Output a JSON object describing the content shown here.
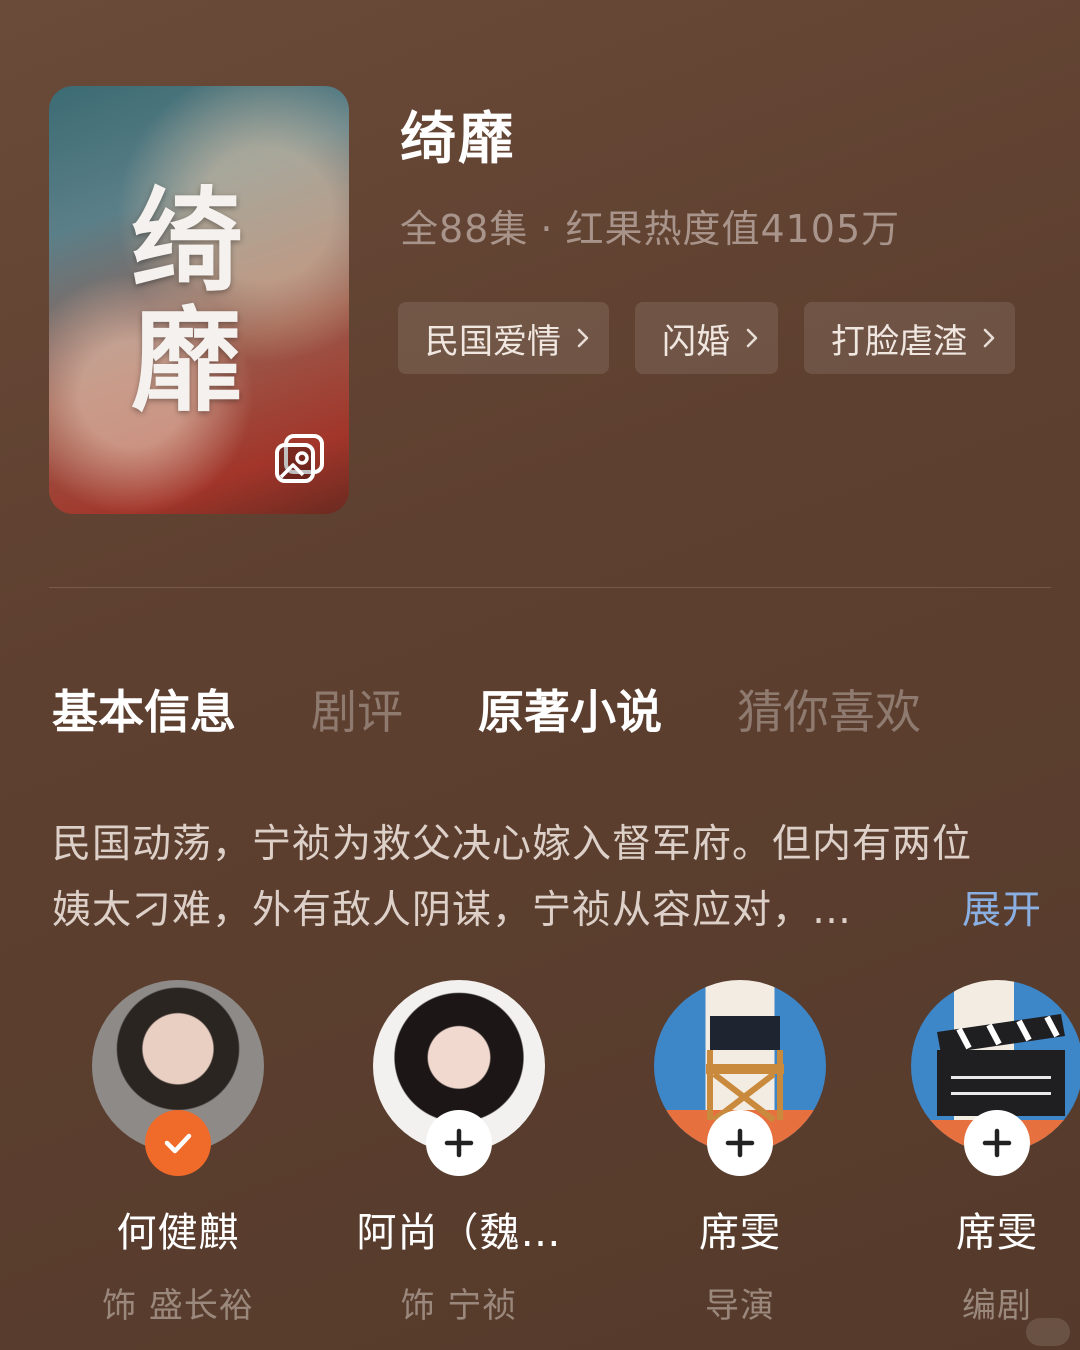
{
  "drama": {
    "title": "绮靡",
    "episodes": "全88集",
    "separator": "·",
    "heat": "红果热度值4105万",
    "poster_text": "绮靡",
    "tags": [
      "民国爱情",
      "闪婚",
      "打脸虐渣"
    ]
  },
  "tabs": [
    {
      "label": "基本信息",
      "active": true
    },
    {
      "label": "剧评",
      "active": false
    },
    {
      "label": "原著小说",
      "active": true
    },
    {
      "label": "猜你喜欢",
      "active": false
    }
  ],
  "synopsis": {
    "line1": "民国动荡，宁祯为救父决心嫁入督军府。但内有两位",
    "line2": "姨太刁难，外有敌人阴谋，宁祯从容应对，…",
    "expand": "展开"
  },
  "cast": [
    {
      "name": "何健麒",
      "role": "饰 盛长裕",
      "status": "followed"
    },
    {
      "name": "阿尚（魏…",
      "role": "饰 宁祯",
      "status": "follow"
    },
    {
      "name": "席雯",
      "role": "导演",
      "status": "follow"
    },
    {
      "name": "席雯",
      "role": "编剧",
      "status": "follow"
    }
  ],
  "icons": {
    "gallery": "gallery-icon",
    "chevron": "chevron-right-icon",
    "plus": "plus-icon",
    "check": "check-icon"
  },
  "colors": {
    "accent_follow": "#f06a2a",
    "link": "#8ab0e3"
  }
}
